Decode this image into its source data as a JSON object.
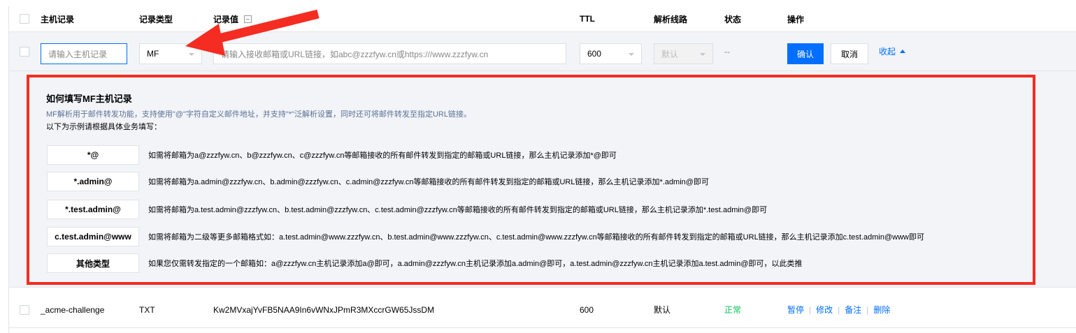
{
  "header": {
    "host_record": "主机记录",
    "record_type": "记录类型",
    "record_value": "记录值",
    "ttl": "TTL",
    "line": "解析线路",
    "status": "状态",
    "actions": "操作"
  },
  "edit_row": {
    "host_placeholder": "请输入主机记录",
    "type_value": "MF",
    "value_placeholder": "请输入接收邮箱或URL链接，如abc@zzzfyw.cn或https:///www.zzzfyw.cn",
    "ttl_value": "600",
    "line_value": "默认",
    "status_value": "--",
    "confirm_label": "确认",
    "cancel_label": "取消",
    "collapse_label": "收起"
  },
  "help": {
    "title": "如何填写MF主机记录",
    "description": "MF解析用于邮件转发功能，支持使用\"@\"字符自定义邮件地址，并支持\"*\"泛解析设置，同时还可将邮件转发至指定URL链接。",
    "intro": "以下为示例请根据具体业务填写：",
    "examples": [
      {
        "label": "*@",
        "text": "如需将邮箱为a@zzzfyw.cn、b@zzzfyw.cn、c@zzzfyw.cn等邮箱接收的所有邮件转发到指定的邮箱或URL链接，那么主机记录添加*@即可"
      },
      {
        "label": "*.admin@",
        "text": "如需将邮箱为a.admin@zzzfyw.cn、b.admin@zzzfyw.cn、c.admin@zzzfyw.cn等邮箱接收的所有邮件转发到指定的邮箱或URL链接，那么主机记录添加*.admin@即可"
      },
      {
        "label": "*.test.admin@",
        "text": "如需将邮箱为a.test.admin@zzzfyw.cn、b.test.admin@zzzfyw.cn、c.test.admin@zzzfyw.cn等邮箱接收的所有邮件转发到指定的邮箱或URL链接，那么主机记录添加*.test.admin@即可"
      },
      {
        "label": "c.test.admin@www",
        "text": "如需将邮箱为二级等更多邮箱格式如：a.test.admin@www.zzzfyw.cn、b.test.admin@www.zzzfyw.cn、c.test.admin@www.zzzfyw.cn等邮箱接收的所有邮件转发到指定的邮箱或URL链接，那么主机记录添加c.test.admin@www即可"
      },
      {
        "label": "其他类型",
        "text": "如果您仅需转发指定的一个邮箱如：a@zzzfyw.cn主机记录添加a@即可，a.admin@zzzfyw.cn主机记录添加a.admin@即可，a.test.admin@zzzfyw.cn主机记录添加a.test.admin@即可，以此类推"
      }
    ]
  },
  "record": {
    "host": "_acme-challenge",
    "type": "TXT",
    "value": "Kw2MVxajYvFB5NAA9In6vWNxJPmR3MXccrGW65JssDM",
    "ttl": "600",
    "line": "默认",
    "status": "正常",
    "actions": [
      "暂停",
      "修改",
      "备注",
      "删除"
    ]
  },
  "colors": {
    "accent": "#006eff",
    "highlight_border": "#f52c21",
    "status_ok": "#0abf5b",
    "arrow": "#f52c21"
  },
  "icons": {
    "record_value_header": "edit-icon",
    "annotation": "red-arrow-icon"
  }
}
